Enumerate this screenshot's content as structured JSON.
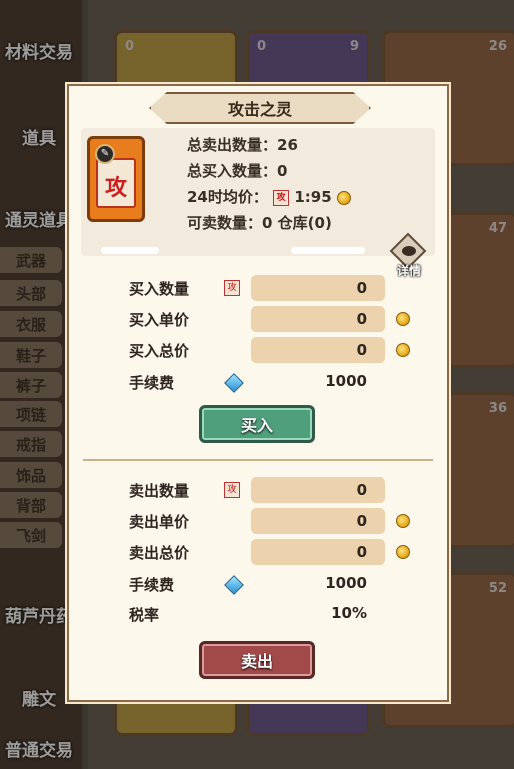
{
  "sidebar": {
    "categories": [
      "材料交易",
      "道具",
      "通灵道具",
      "葫芦丹药",
      "雕文",
      "普通交易"
    ],
    "subcategories": [
      "武器",
      "头部",
      "衣服",
      "鞋子",
      "裤子",
      "项链",
      "戒指",
      "饰品",
      "背部",
      "飞剑"
    ]
  },
  "background_cards": {
    "counts": [
      "0",
      "0",
      "9",
      "26",
      "47",
      "36",
      "52"
    ]
  },
  "dialog": {
    "title": "攻击之灵",
    "item_glyph": "攻",
    "stats": {
      "total_sold": "总卖出数量：26",
      "total_bought": "总买入数量：0",
      "avg_price_label": "24时均价：",
      "avg_price_value": "1:95",
      "sellable": "可卖数量：0 仓库(0)"
    },
    "details_label": "详情",
    "buy": {
      "qty_label": "买入数量",
      "qty_value": "0",
      "unit_label": "买入单价",
      "unit_value": "0",
      "total_label": "买入总价",
      "total_value": "0",
      "fee_label": "手续费",
      "fee_value": "1000",
      "button": "买入"
    },
    "sell": {
      "qty_label": "卖出数量",
      "qty_value": "0",
      "unit_label": "卖出单价",
      "unit_value": "0",
      "total_label": "卖出总价",
      "total_value": "0",
      "fee_label": "手续费",
      "fee_value": "1000",
      "tax_label": "税率",
      "tax_value": "10%",
      "button": "卖出"
    }
  },
  "colors": {
    "buy_button": "#4f9e7c",
    "sell_button": "#a24a49",
    "field_bg": "#ecd3ad"
  }
}
